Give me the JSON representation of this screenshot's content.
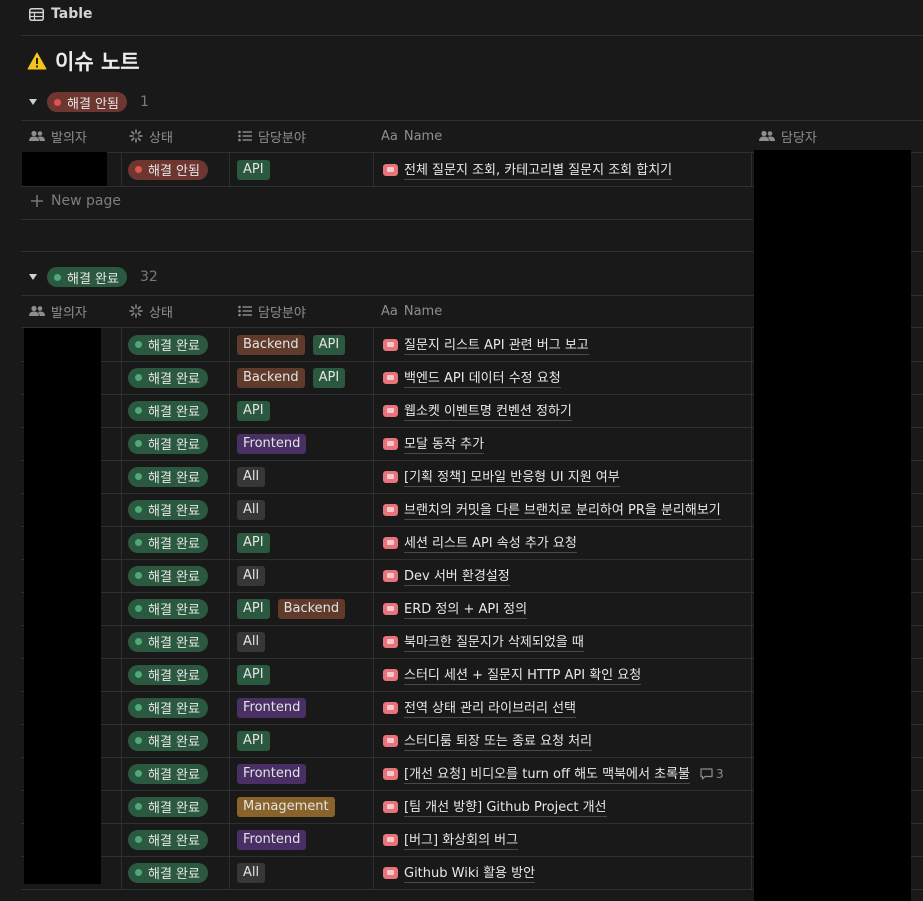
{
  "topbar": {
    "view_label": "Table",
    "view_icon": "table-icon"
  },
  "page": {
    "title": "이슈 노트",
    "title_icon": "warning-icon"
  },
  "columns": {
    "reporter": "발의자",
    "status": "상태",
    "area": "담당분야",
    "name": "Name",
    "assignee": "담당자"
  },
  "new_page": "New page",
  "groups": [
    {
      "label": "해결 안됨",
      "count": "1",
      "rows": [
        {
          "status": "해결 안됨",
          "tags": [
            {
              "label": "API",
              "kind": "api"
            }
          ],
          "name": "전체 질문지 조회, 카테고리별 질문지 조회 합치기"
        }
      ]
    },
    {
      "label": "해결 완료",
      "count": "32",
      "rows": [
        {
          "status": "해결 완료",
          "tags": [
            {
              "label": "Backend",
              "kind": "backend"
            },
            {
              "label": "API",
              "kind": "api"
            }
          ],
          "name": "질문지 리스트 API 관련 버그 보고"
        },
        {
          "status": "해결 완료",
          "tags": [
            {
              "label": "Backend",
              "kind": "backend"
            },
            {
              "label": "API",
              "kind": "api"
            }
          ],
          "name": "백엔드 API 데이터 수정 요청"
        },
        {
          "status": "해결 완료",
          "tags": [
            {
              "label": "API",
              "kind": "api"
            }
          ],
          "name": "웹소켓 이벤트명 컨벤션  정하기"
        },
        {
          "status": "해결 완료",
          "tags": [
            {
              "label": "Frontend",
              "kind": "frontend"
            }
          ],
          "name": "모달 동작 추가"
        },
        {
          "status": "해결 완료",
          "tags": [
            {
              "label": "All",
              "kind": "all"
            }
          ],
          "name": "[기획 정책] 모바일 반응형 UI 지원 여부"
        },
        {
          "status": "해결 완료",
          "tags": [
            {
              "label": "All",
              "kind": "all"
            }
          ],
          "name": "브랜치의 커밋을 다른 브랜치로 분리하여 PR을 분리해보기"
        },
        {
          "status": "해결 완료",
          "tags": [
            {
              "label": "API",
              "kind": "api"
            }
          ],
          "name": "세션 리스트 API 속성 추가 요청"
        },
        {
          "status": "해결 완료",
          "tags": [
            {
              "label": "All",
              "kind": "all"
            }
          ],
          "name": "Dev 서버 환경설정"
        },
        {
          "status": "해결 완료",
          "tags": [
            {
              "label": "API",
              "kind": "api"
            },
            {
              "label": "Backend",
              "kind": "backend"
            }
          ],
          "name": "ERD 정의 + API 정의"
        },
        {
          "status": "해결 완료",
          "tags": [
            {
              "label": "All",
              "kind": "all"
            }
          ],
          "name": "북마크한 질문지가 삭제되었을 때"
        },
        {
          "status": "해결 완료",
          "tags": [
            {
              "label": "API",
              "kind": "api"
            }
          ],
          "name": "스터디 세션 + 질문지 HTTP API 확인 요청"
        },
        {
          "status": "해결 완료",
          "tags": [
            {
              "label": "Frontend",
              "kind": "frontend"
            }
          ],
          "name": "전역 상태 관리 라이브러리 선택"
        },
        {
          "status": "해결 완료",
          "tags": [
            {
              "label": "API",
              "kind": "api"
            }
          ],
          "name": "스터디룸 퇴장 또는 종료 요청 처리"
        },
        {
          "status": "해결 완료",
          "tags": [
            {
              "label": "Frontend",
              "kind": "frontend"
            }
          ],
          "name": "[개선 요청] 비디오를 turn off 해도 맥북에서 초록불",
          "comments": "3"
        },
        {
          "status": "해결 완료",
          "tags": [
            {
              "label": "Management",
              "kind": "management"
            }
          ],
          "name": "[팀 개선 방향] Github Project 개선"
        },
        {
          "status": "해결 완료",
          "tags": [
            {
              "label": "Frontend",
              "kind": "frontend"
            }
          ],
          "name": "[버그] 화상회의 버그"
        },
        {
          "status": "해결 완료",
          "tags": [
            {
              "label": "All",
              "kind": "all"
            }
          ],
          "name": "Github Wiki 활용 방안"
        }
      ]
    }
  ]
}
